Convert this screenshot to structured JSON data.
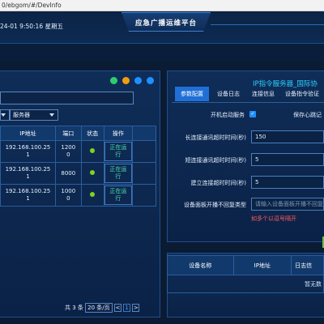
{
  "browser": {
    "url": "0/ebgom/#/DevInfo"
  },
  "header": {
    "datetime": "24-01 9:50:16 星期五",
    "title": "应急广播运维平台"
  },
  "left": {
    "action_dots": [
      {
        "icon": "refresh-icon",
        "color": "#2ecc71"
      },
      {
        "icon": "settings-icon",
        "color": "#f39c12"
      },
      {
        "icon": "add-icon",
        "color": "#1e90ff"
      },
      {
        "icon": "info-icon",
        "color": "#1e90ff"
      }
    ],
    "filter": {
      "type_select": "服务器"
    },
    "table": {
      "headers": [
        "IP地址",
        "端口",
        "状态",
        "操作"
      ],
      "rows": [
        {
          "ip_1": "192.168.100.25",
          "ip_2": "1",
          "port_1": "1200",
          "port_2": "0",
          "action": "正在运行"
        },
        {
          "ip_1": "192.168.100.25",
          "ip_2": "1",
          "port_1": "8000",
          "port_2": "",
          "action": "正在运行"
        },
        {
          "ip_1": "192.168.100.25",
          "ip_2": "1",
          "port_1": "1000",
          "port_2": "0",
          "action": "正在运行"
        }
      ]
    },
    "pager": {
      "total": "共 3 条",
      "page_size": "20 条/页",
      "prev": "<",
      "current": "1",
      "next": ">"
    }
  },
  "right": {
    "title": "IP指令服务器_国际协",
    "tabs": [
      "参数配置",
      "设备日志",
      "连接信息",
      "设备指令验证"
    ],
    "form": {
      "autostart_label": "开机启动服务",
      "keepalive_label": "保存心跳记",
      "long_timeout_label": "长连接通讯超时时间(秒)",
      "long_timeout_value": "150",
      "short_timeout_label": "短连接通讯超时时间(秒)",
      "short_timeout_value": "5",
      "connect_timeout_label": "建立连接超时时间(秒)",
      "connect_timeout_value": "5",
      "panel_type_label": "设备面板开播不回复类型",
      "panel_type_placeholder": "请输入设备面板开播不回复",
      "hint": "如多个以逗号隔开"
    },
    "log_table": {
      "headers": [
        "设备名称",
        "IP地址",
        "日志信"
      ],
      "empty": "暂无数"
    }
  }
}
